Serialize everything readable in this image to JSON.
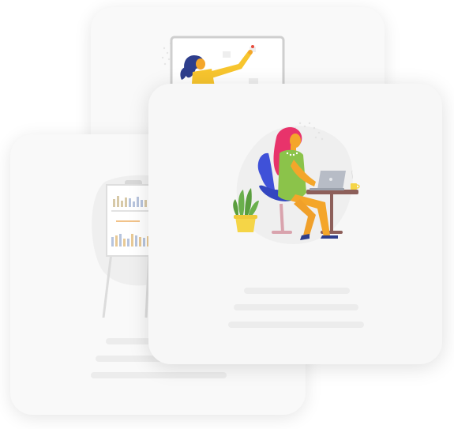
{
  "cards": {
    "back": {
      "illustration": "woman-pinning-notes-illustration"
    },
    "left": {
      "illustration": "flipchart-bar-chart-illustration"
    },
    "front": {
      "illustration": "woman-working-on-laptop-illustration"
    }
  },
  "placeholder_color": "#ececec",
  "colors": {
    "hair_pink": "#e8336b",
    "dress_green": "#8bc34a",
    "chair_blue": "#3f51d8",
    "skin_orange": "#f4a62a",
    "table_brown": "#8d5f5a",
    "plant_green": "#6ab04c",
    "pot_yellow": "#f5d547",
    "laptop_gray": "#b7bcc6",
    "shirt_yellow": "#f7c52e"
  }
}
